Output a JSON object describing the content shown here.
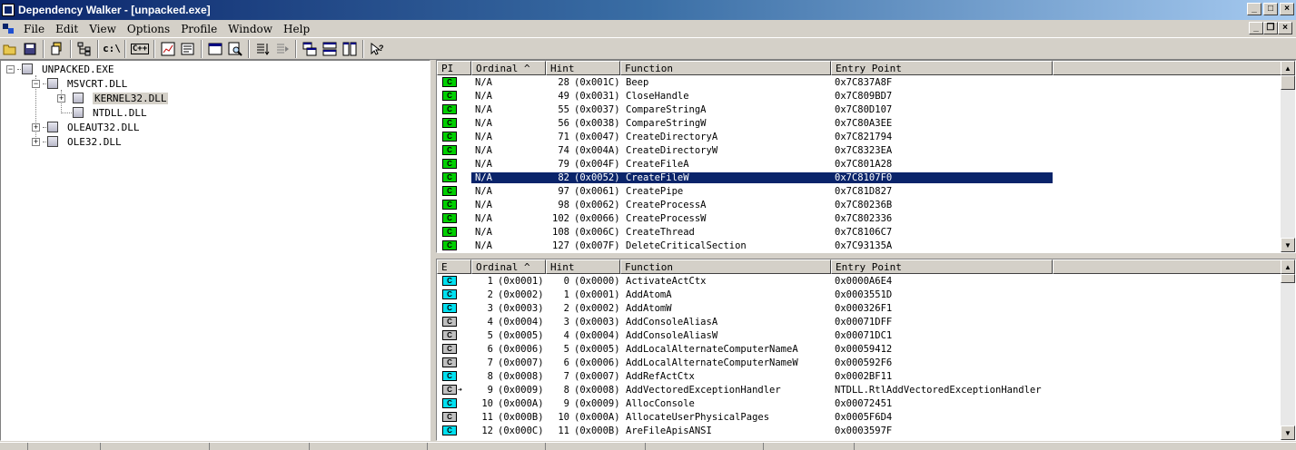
{
  "window": {
    "title": "Dependency Walker - [unpacked.exe]"
  },
  "menu": [
    "File",
    "Edit",
    "View",
    "Options",
    "Profile",
    "Window",
    "Help"
  ],
  "toolbar": {
    "path_label": "c:\\",
    "cpp_label": "C++"
  },
  "tree": {
    "root": "UNPACKED.EXE",
    "msvcrt": "MSVCRT.DLL",
    "kernel32": "KERNEL32.DLL",
    "ntdll": "NTDLL.DLL",
    "oleaut32": "OLEAUT32.DLL",
    "ole32": "OLE32.DLL"
  },
  "imports": {
    "headers": [
      "PI",
      "Ordinal ^",
      "Hint",
      "Function",
      "Entry Point"
    ],
    "rows": [
      {
        "badge": "C",
        "badge_color": "green",
        "ordinal": "N/A",
        "hint": "28",
        "hint_hex": "(0x001C)",
        "function": "Beep",
        "entry": "0x7C837A8F"
      },
      {
        "badge": "C",
        "badge_color": "green",
        "ordinal": "N/A",
        "hint": "49",
        "hint_hex": "(0x0031)",
        "function": "CloseHandle",
        "entry": "0x7C809BD7"
      },
      {
        "badge": "C",
        "badge_color": "green",
        "ordinal": "N/A",
        "hint": "55",
        "hint_hex": "(0x0037)",
        "function": "CompareStringA",
        "entry": "0x7C80D107"
      },
      {
        "badge": "C",
        "badge_color": "green",
        "ordinal": "N/A",
        "hint": "56",
        "hint_hex": "(0x0038)",
        "function": "CompareStringW",
        "entry": "0x7C80A3EE"
      },
      {
        "badge": "C",
        "badge_color": "green",
        "ordinal": "N/A",
        "hint": "71",
        "hint_hex": "(0x0047)",
        "function": "CreateDirectoryA",
        "entry": "0x7C821794"
      },
      {
        "badge": "C",
        "badge_color": "green",
        "ordinal": "N/A",
        "hint": "74",
        "hint_hex": "(0x004A)",
        "function": "CreateDirectoryW",
        "entry": "0x7C8323EA"
      },
      {
        "badge": "C",
        "badge_color": "green",
        "ordinal": "N/A",
        "hint": "79",
        "hint_hex": "(0x004F)",
        "function": "CreateFileA",
        "entry": "0x7C801A28"
      },
      {
        "badge": "C",
        "badge_color": "green",
        "ordinal": "N/A",
        "hint": "82",
        "hint_hex": "(0x0052)",
        "function": "CreateFileW",
        "entry": "0x7C8107F0",
        "selected": true
      },
      {
        "badge": "C",
        "badge_color": "green",
        "ordinal": "N/A",
        "hint": "97",
        "hint_hex": "(0x0061)",
        "function": "CreatePipe",
        "entry": "0x7C81D827"
      },
      {
        "badge": "C",
        "badge_color": "green",
        "ordinal": "N/A",
        "hint": "98",
        "hint_hex": "(0x0062)",
        "function": "CreateProcessA",
        "entry": "0x7C80236B"
      },
      {
        "badge": "C",
        "badge_color": "green",
        "ordinal": "N/A",
        "hint": "102",
        "hint_hex": "(0x0066)",
        "function": "CreateProcessW",
        "entry": "0x7C802336"
      },
      {
        "badge": "C",
        "badge_color": "green",
        "ordinal": "N/A",
        "hint": "108",
        "hint_hex": "(0x006C)",
        "function": "CreateThread",
        "entry": "0x7C8106C7"
      },
      {
        "badge": "C",
        "badge_color": "green",
        "ordinal": "N/A",
        "hint": "127",
        "hint_hex": "(0x007F)",
        "function": "DeleteCriticalSection",
        "entry": "0x7C93135A"
      }
    ]
  },
  "exports": {
    "headers": [
      "E",
      "Ordinal ^",
      "Hint",
      "Function",
      "Entry Point"
    ],
    "rows": [
      {
        "badge": "C",
        "badge_color": "cyan",
        "ordinal": "1",
        "ordinal_hex": "(0x0001)",
        "hint": "0",
        "hint_hex": "(0x0000)",
        "function": "ActivateActCtx",
        "entry": "0x0000A6E4"
      },
      {
        "badge": "C",
        "badge_color": "cyan",
        "ordinal": "2",
        "ordinal_hex": "(0x0002)",
        "hint": "1",
        "hint_hex": "(0x0001)",
        "function": "AddAtomA",
        "entry": "0x0003551D"
      },
      {
        "badge": "C",
        "badge_color": "cyan",
        "ordinal": "3",
        "ordinal_hex": "(0x0003)",
        "hint": "2",
        "hint_hex": "(0x0002)",
        "function": "AddAtomW",
        "entry": "0x000326F1"
      },
      {
        "badge": "C",
        "badge_color": "gray",
        "ordinal": "4",
        "ordinal_hex": "(0x0004)",
        "hint": "3",
        "hint_hex": "(0x0003)",
        "function": "AddConsoleAliasA",
        "entry": "0x00071DFF"
      },
      {
        "badge": "C",
        "badge_color": "gray",
        "ordinal": "5",
        "ordinal_hex": "(0x0005)",
        "hint": "4",
        "hint_hex": "(0x0004)",
        "function": "AddConsoleAliasW",
        "entry": "0x00071DC1"
      },
      {
        "badge": "C",
        "badge_color": "gray",
        "ordinal": "6",
        "ordinal_hex": "(0x0006)",
        "hint": "5",
        "hint_hex": "(0x0005)",
        "function": "AddLocalAlternateComputerNameA",
        "entry": "0x00059412"
      },
      {
        "badge": "C",
        "badge_color": "gray",
        "ordinal": "7",
        "ordinal_hex": "(0x0007)",
        "hint": "6",
        "hint_hex": "(0x0006)",
        "function": "AddLocalAlternateComputerNameW",
        "entry": "0x000592F6"
      },
      {
        "badge": "C",
        "badge_color": "cyan",
        "ordinal": "8",
        "ordinal_hex": "(0x0008)",
        "hint": "7",
        "hint_hex": "(0x0007)",
        "function": "AddRefActCtx",
        "entry": "0x0002BF11"
      },
      {
        "badge": "C",
        "badge_color": "gray",
        "forwarded": true,
        "ordinal": "9",
        "ordinal_hex": "(0x0009)",
        "hint": "8",
        "hint_hex": "(0x0008)",
        "function": "AddVectoredExceptionHandler",
        "entry": "NTDLL.RtlAddVectoredExceptionHandler"
      },
      {
        "badge": "C",
        "badge_color": "cyan",
        "ordinal": "10",
        "ordinal_hex": "(0x000A)",
        "hint": "9",
        "hint_hex": "(0x0009)",
        "function": "AllocConsole",
        "entry": "0x00072451"
      },
      {
        "badge": "C",
        "badge_color": "gray",
        "ordinal": "11",
        "ordinal_hex": "(0x000B)",
        "hint": "10",
        "hint_hex": "(0x000A)",
        "function": "AllocateUserPhysicalPages",
        "entry": "0x0005F6D4"
      },
      {
        "badge": "C",
        "badge_color": "cyan",
        "ordinal": "12",
        "ordinal_hex": "(0x000C)",
        "hint": "11",
        "hint_hex": "(0x000B)",
        "function": "AreFileApisANSI",
        "entry": "0x0003597F"
      }
    ]
  },
  "colors": {
    "green": "#00d000",
    "cyan": "#00e0f0",
    "gray": "#c0c0c0",
    "selection": "#0a246a"
  }
}
